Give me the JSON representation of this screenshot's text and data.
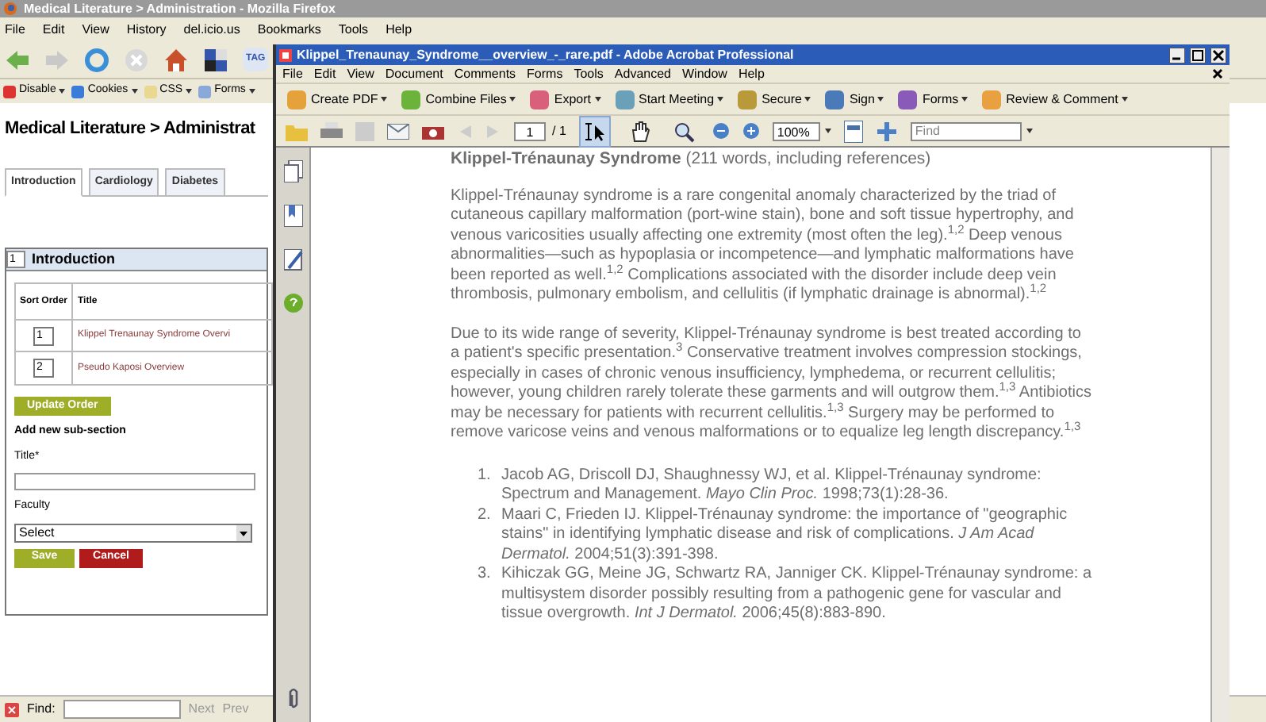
{
  "browser": {
    "title": "Medical Literature > Administration - Mozilla Firefox",
    "menu": [
      "File",
      "Edit",
      "View",
      "History",
      "del.icio.us",
      "Bookmarks",
      "Tools",
      "Help"
    ],
    "tag_icon_text": "TAG",
    "dev_toolbar": [
      "Disable",
      "Cookies",
      "CSS",
      "Forms"
    ]
  },
  "page": {
    "heading": "Medical Literature > Administrat",
    "tabs": [
      {
        "label": "Introduction",
        "selected": true
      },
      {
        "label": "Cardiology",
        "selected": false
      },
      {
        "label": "Diabetes",
        "selected": false
      }
    ],
    "section": {
      "order": "1",
      "title": "Introduction"
    },
    "table": {
      "columns": [
        "Sort Order",
        "Title"
      ],
      "rows": [
        {
          "order": "1",
          "title": "Klippel Trenaunay Syndrome Overvi"
        },
        {
          "order": "2",
          "title": "Pseudo Kaposi Overview"
        }
      ]
    },
    "update_button": "Update Order",
    "form": {
      "heading": "Add new sub-section",
      "title_label": "Title*",
      "faculty_label": "Faculty",
      "faculty_value": "Select",
      "save": "Save",
      "cancel": "Cancel"
    }
  },
  "find_bar": {
    "label": "Find:",
    "next": "Next",
    "prev": "Prev"
  },
  "acrobat": {
    "title": "Klippel_Trenaunay_Syndrome__overview_-_rare.pdf - Adobe Acrobat Professional",
    "menu": [
      "File",
      "Edit",
      "View",
      "Document",
      "Comments",
      "Forms",
      "Tools",
      "Advanced",
      "Window",
      "Help"
    ],
    "toolbar": [
      "Create PDF",
      "Combine Files",
      "Export",
      "Start Meeting",
      "Secure",
      "Sign",
      "Forms",
      "Review & Comment"
    ],
    "page_number": "1",
    "page_count": "/ 1",
    "view_tools": [
      {
        "selected": true
      },
      {
        "selected": false
      },
      {
        "selected": false
      }
    ],
    "zoom": "100%",
    "find_placeholder": "Find",
    "document": {
      "heading": "**Klippel-Trénaunay Syndrome** (211 words, including references)",
      "paragraphs": [
        "Klippel-Trénaunay syndrome is a rare congenital anomaly characterized by the triad of cutaneous capillary malformation (port-wine stain), bone and soft tissue hypertrophy, and venous varicosities usually affecting one extremity (most often the leg).$^{1,2}$ Deep venous abnormalities—such as hypoplasia or incompetence—and lymphatic malformations have been reported as well.$^{1,2}$ Complications associated with the disorder include deep vein thrombosis, pulmonary embolism, and cellulitis (if lymphatic drainage is abnormal).$^{1,2}$",
        "Due to its wide range of severity, Klippel-Trénaunay syndrome is best treated according to a patient's specific presentation.$^{3}$ Conservative treatment involves compression stockings, especially in cases of chronic venous insufficiency, lymphedema, or recurrent cellulitis; however, young children rarely tolerate these garments and will outgrow them.$^{1,3}$ Antibiotics may be necessary for patients with recurrent cellulitis.$^{1,3}$ Surgery may be performed to remove varicose veins and venous malformations or to equalize leg length discrepancy.$^{1,3}$"
      ],
      "references": [
        {
          "number": "1.",
          "text": "Jacob AG, Driscoll DJ, Shaughnessy WJ, et al. Klippel-Trénaunay syndrome: Spectrum and Management. *Mayo Clin Proc.* 1998;73(1):28-36."
        },
        {
          "number": "2.",
          "text": "Maari C, Frieden IJ. Klippel-Trénaunay syndrome: the importance of \"geographic stains\" in identifying lymphatic disease and risk of complications. *J Am Acad Dermatol.* 2004;51(3):391-398."
        },
        {
          "number": "3.",
          "text": "Kihiczak GG, Meine JG, Schwartz RA, Janniger CK. Klippel-Trénaunay syndrome: a multisystem disorder possibly resulting from a pathogenic gene for vascular and tissue overgrowth. *Int J Dermatol.* 2006;45(8):883-890."
        }
      ]
    }
  }
}
